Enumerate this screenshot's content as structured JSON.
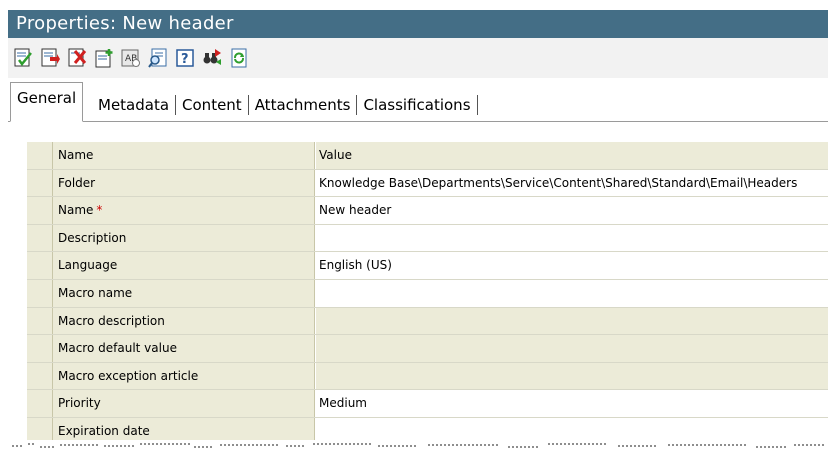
{
  "window": {
    "title": "Properties: New header"
  },
  "toolbar": {
    "buttons": [
      {
        "icon": "save-close-icon"
      },
      {
        "icon": "save-icon"
      },
      {
        "icon": "delete-icon"
      },
      {
        "icon": "new-item-icon"
      },
      {
        "icon": "spellcheck-icon"
      },
      {
        "icon": "preview-icon"
      },
      {
        "icon": "help-icon"
      },
      {
        "icon": "find-replace-icon"
      },
      {
        "icon": "refresh-icon"
      }
    ]
  },
  "tabs": [
    {
      "label": "General",
      "active": true
    },
    {
      "label": "Metadata"
    },
    {
      "label": "Content"
    },
    {
      "label": "Attachments"
    },
    {
      "label": "Classifications"
    }
  ],
  "grid": {
    "header": {
      "name": "Name",
      "value": "Value"
    },
    "rows": [
      {
        "name": "Folder",
        "value": "Knowledge Base\\Departments\\Service\\Content\\Shared\\Standard\\Email\\Headers",
        "editable": true
      },
      {
        "name": "Name",
        "required_mark": "*",
        "value": "New header",
        "editable": true
      },
      {
        "name": "Description",
        "value": "",
        "editable": true
      },
      {
        "name": "Language",
        "value": "English (US)",
        "editable": true
      },
      {
        "name": "Macro name",
        "value": "",
        "editable": true
      },
      {
        "name": "Macro description",
        "value": "",
        "editable": false
      },
      {
        "name": "Macro default value",
        "value": "",
        "editable": false
      },
      {
        "name": "Macro exception article",
        "value": "",
        "editable": false
      },
      {
        "name": "Priority",
        "value": "Medium",
        "editable": true
      },
      {
        "name": "Expiration date",
        "value": "",
        "editable": true
      }
    ]
  },
  "colors": {
    "titlebar": "#446e86",
    "grid_label_bg": "#ecebd8",
    "required": "#cc0000"
  }
}
